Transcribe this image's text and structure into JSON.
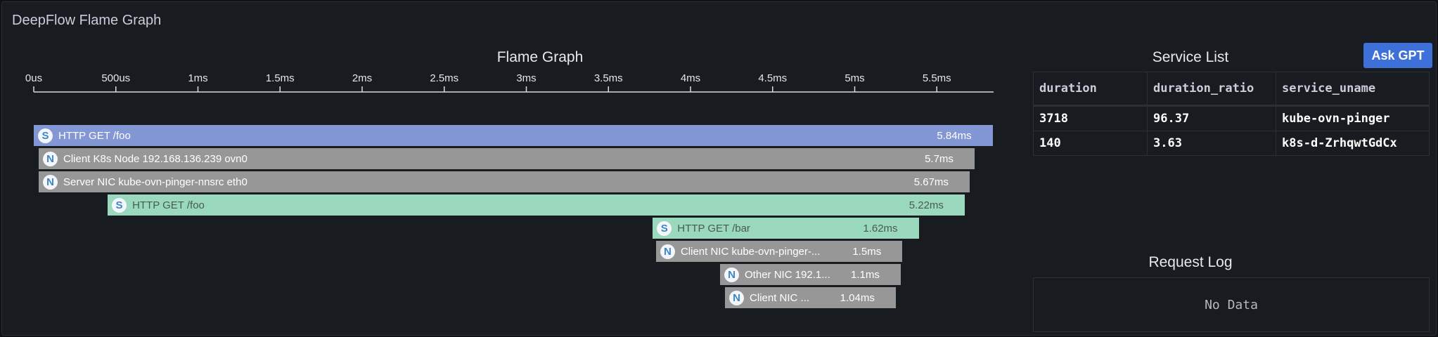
{
  "panel": {
    "title": "DeepFlow Flame Graph"
  },
  "ask_gpt": {
    "label": "Ask GPT"
  },
  "flame_graph": {
    "title": "Flame Graph",
    "axis_ticks": [
      "0us",
      "500us",
      "1ms",
      "1.5ms",
      "2ms",
      "2.5ms",
      "3ms",
      "3.5ms",
      "4ms",
      "4.5ms",
      "5ms",
      "5.5ms"
    ],
    "spans": [
      {
        "icon": "S",
        "name": "HTTP GET /foo",
        "duration": "5.84ms",
        "start_ms": 0.0,
        "duration_ms": 5.84,
        "kind": "service"
      },
      {
        "icon": "N",
        "name": "Client K8s Node 192.168.136.239 ovn0",
        "duration": "5.7ms",
        "start_ms": 0.03,
        "duration_ms": 5.7,
        "kind": "network"
      },
      {
        "icon": "N",
        "name": "Server NIC kube-ovn-pinger-nnsrc eth0",
        "duration": "5.67ms",
        "start_ms": 0.03,
        "duration_ms": 5.67,
        "kind": "network"
      },
      {
        "icon": "S",
        "name": "HTTP GET /foo",
        "duration": "5.22ms",
        "start_ms": 0.45,
        "duration_ms": 5.22,
        "kind": "app"
      },
      {
        "icon": "S",
        "name": "HTTP GET /bar",
        "duration": "1.62ms",
        "start_ms": 3.77,
        "duration_ms": 1.62,
        "kind": "app"
      },
      {
        "icon": "N",
        "name": "Client NIC kube-ovn-pinger-...",
        "duration": "1.5ms",
        "start_ms": 3.79,
        "duration_ms": 1.5,
        "kind": "network"
      },
      {
        "icon": "N",
        "name": "Other NIC 192.1...",
        "duration": "1.1ms",
        "start_ms": 4.18,
        "duration_ms": 1.1,
        "kind": "network"
      },
      {
        "icon": "N",
        "name": "Client NIC ...",
        "duration": "1.04ms",
        "start_ms": 4.21,
        "duration_ms": 1.04,
        "kind": "network"
      }
    ],
    "colors": {
      "service": "#8297d4",
      "network": "#979797",
      "app": "#9ad9bd"
    }
  },
  "service_list": {
    "title": "Service List",
    "columns": [
      "duration",
      "duration_ratio",
      "service_uname"
    ],
    "rows": [
      [
        "3718",
        "96.37",
        "kube-ovn-pinger"
      ],
      [
        "140",
        "3.63",
        "k8s-d-ZrhqwtGdCx"
      ]
    ]
  },
  "request_log": {
    "title": "Request Log",
    "empty_text": "No Data"
  }
}
